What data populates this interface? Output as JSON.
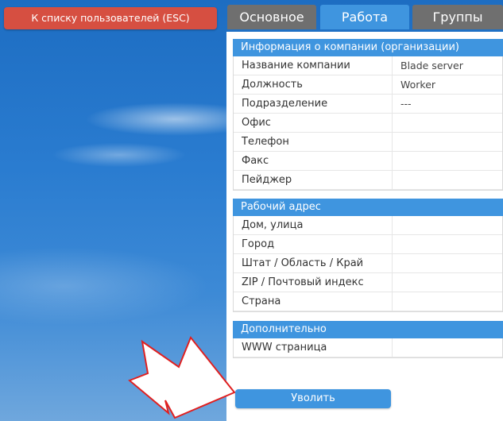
{
  "back_button": {
    "label": "К списку пользователей (ESC)"
  },
  "tabs": [
    {
      "label": "Основное",
      "active": false
    },
    {
      "label": "Работа",
      "active": true
    },
    {
      "label": "Группы",
      "active": false
    }
  ],
  "company_section": {
    "title": "Информация о компании (организации)",
    "rows": [
      {
        "label": "Название компании",
        "value": "Blade server"
      },
      {
        "label": "Должность",
        "value": "Worker"
      },
      {
        "label": "Подразделение",
        "value": "---"
      },
      {
        "label": "Офис",
        "value": ""
      },
      {
        "label": "Телефон",
        "value": ""
      },
      {
        "label": "Факс",
        "value": ""
      },
      {
        "label": "Пейджер",
        "value": ""
      }
    ]
  },
  "address_section": {
    "title": "Рабочий адрес",
    "rows": [
      {
        "label": "Дом, улица",
        "value": ""
      },
      {
        "label": "Город",
        "value": ""
      },
      {
        "label": "Штат / Область / Край",
        "value": ""
      },
      {
        "label": "ZIP / Почтовый индекс",
        "value": ""
      },
      {
        "label": "Страна",
        "value": ""
      }
    ]
  },
  "extra_section": {
    "title": "Дополнительно",
    "rows": [
      {
        "label": "WWW страница",
        "value": ""
      }
    ]
  },
  "fire_button": {
    "label": "Уволить"
  },
  "colors": {
    "accent": "#3f95df",
    "tab_inactive": "#6f6f6f",
    "back_button": "#d64f41",
    "arrow_stroke": "#e02020"
  },
  "icons": {
    "pointer": "arrow-pointer-icon"
  }
}
